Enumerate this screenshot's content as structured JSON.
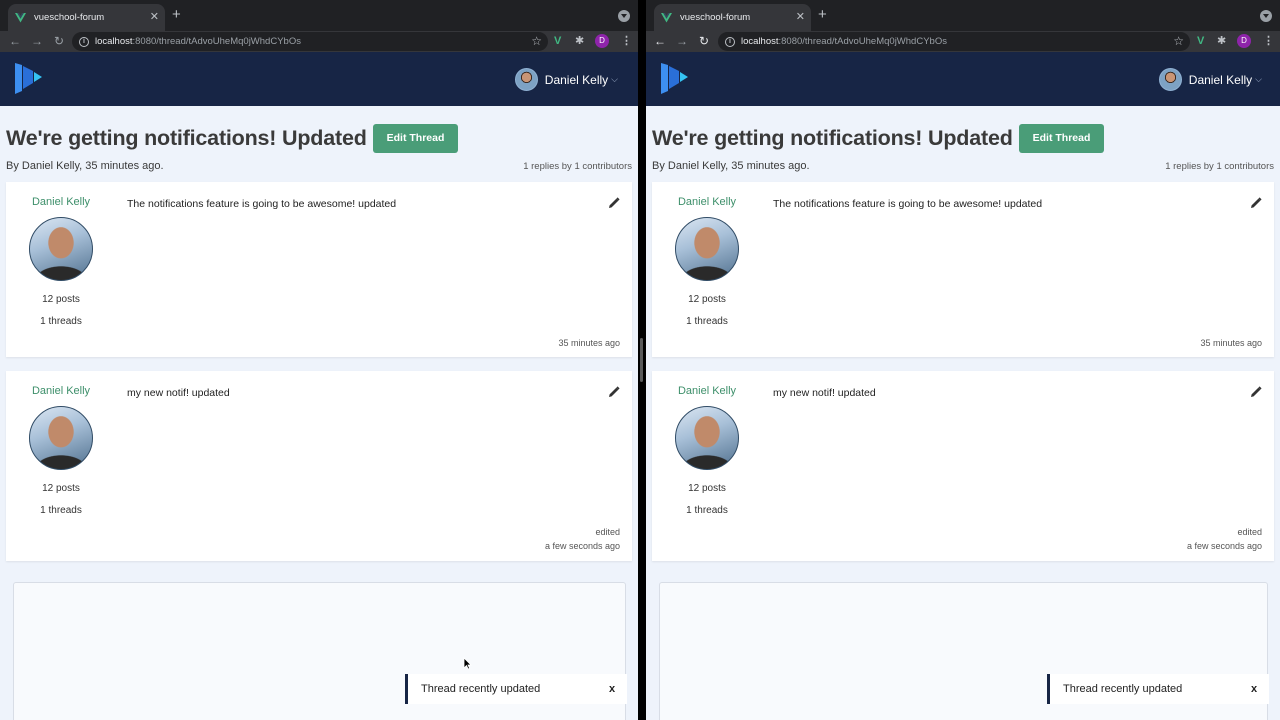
{
  "browser": {
    "tab_title": "vueschool-forum",
    "url_host": "localhost",
    "url_path": ":8080/thread/tAdvoUheMq0jWhdCYbOs",
    "profile_initial": "D"
  },
  "header": {
    "user_name": "Daniel Kelly"
  },
  "thread": {
    "title": "We're getting notifications! Updated",
    "edit_label": "Edit Thread",
    "byline": "By Daniel Kelly, 35 minutes ago.",
    "stats": "1 replies by 1 contributors"
  },
  "posts": [
    {
      "author": "Daniel Kelly",
      "text": "The notifications feature is going to be awesome! updated",
      "posts_count": "12 posts",
      "threads_count": "1 threads",
      "date": "35 minutes ago"
    },
    {
      "author": "Daniel Kelly",
      "text": "my new notif! updated",
      "posts_count": "12 posts",
      "threads_count": "1 threads",
      "edited": "edited",
      "date": "a few seconds ago"
    }
  ],
  "toast": {
    "message": "Thread recently updated",
    "close": "x"
  }
}
